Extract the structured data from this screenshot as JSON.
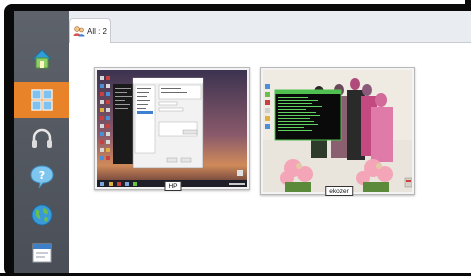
{
  "tab": {
    "label": "All : 2"
  },
  "sidebar": {
    "items": [
      {
        "icon": "home-icon"
      },
      {
        "icon": "grid-view-icon",
        "active": true
      },
      {
        "icon": "headset-icon"
      },
      {
        "icon": "help-icon"
      },
      {
        "icon": "globe-icon"
      },
      {
        "icon": "window-icon"
      }
    ]
  },
  "computers": [
    {
      "label": "HP",
      "screen": "desktop-with-dialog"
    },
    {
      "label": "ekozer",
      "screen": "family-photo-with-terminal"
    }
  ],
  "colors": {
    "sidebar": "#555a62",
    "active": "#e8832a",
    "tabbar": "#e9edf2"
  }
}
